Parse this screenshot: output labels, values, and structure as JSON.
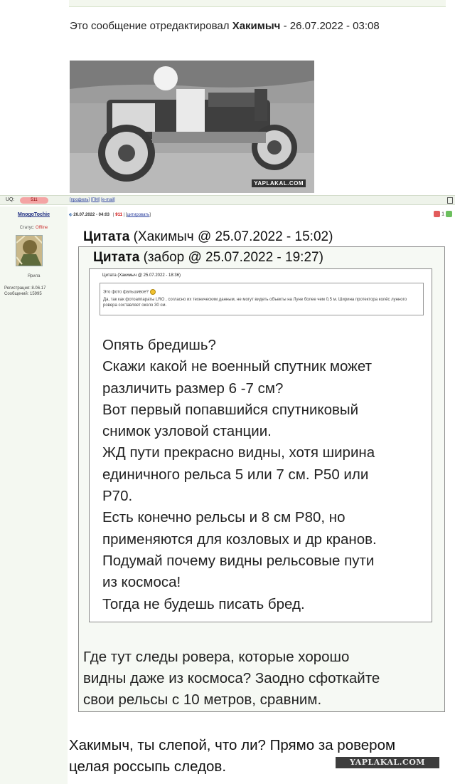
{
  "header": {
    "edited_prefix": "Это сообщение отредактировал",
    "edited_user": "Хакимыч",
    "edited_date": "- 26.07.2022 - 03:08"
  },
  "photo": {
    "watermark": "YAPLAKAL.COM"
  },
  "prev_post_footer": {
    "uq_label": "UQ:",
    "uq_badge": "511",
    "links": [
      "профиль",
      "ПМ",
      "e-mail"
    ]
  },
  "user": {
    "name": "MnogoTochie",
    "status_label": "Статус:",
    "status_value": "Offline",
    "avatar_caption": "Ярила",
    "registration": "Регистрация: 8.06.17",
    "messages": "Сообщений: 15995"
  },
  "post_header": {
    "date": "26.07.2022 - 04:03",
    "number": "911",
    "quote_link": "цитировать",
    "rating": "1"
  },
  "quote1": {
    "label": "Цитата",
    "meta": "(Хакимыч @ 25.07.2022 - 15:02)",
    "lines": [
      "Где тут следы ровера, которые хорошо",
      "видны даже из космоса? Заодно сфоткайте",
      "свои рельсы с 10 метров, сравним."
    ]
  },
  "quote2": {
    "label": "Цитата",
    "meta": "(забор @ 25.07.2022 - 19:27)",
    "lines": [
      "Опять бредишь?",
      "Скажи какой не военный спутник может",
      "различить размер 6 -7 см?",
      "Вот первый попавшийся спутниковый",
      "снимок узловой станции.",
      "ЖД пути прекрасно видны, хотя ширина",
      "единичного рельса 5 или 7 см. Р50 или",
      "Р70.",
      "Есть конечно рельсы и 8 см Р80, но",
      "применяются для козловых и др кранов.",
      "Подумай почему видны рельсовые пути",
      "из космоса!",
      "Тогда не будешь писать бред."
    ]
  },
  "quote3": {
    "head": "Цитата (Хакимыч @ 25.07.2022 - 18:36)",
    "line1": "Это фото фальшивое?",
    "line2": "Да, так как фотоаппараты LRO , согласно их техническим данным, не могут видеть объекты на Луне более чем 0,5 м. Ширина протектора колёс лунного ровера составляет около 30 см."
  },
  "reply": {
    "lines": [
      "Хакимыч, ты слепой, что ли? Прямо за ровером",
      "целая россыпь следов."
    ]
  },
  "watermark": "YAPLAKAL.COM",
  "colors": {
    "link": "#2a3f9e",
    "sidebar_bg": "#f4f8f1",
    "offline": "#cc3333"
  }
}
